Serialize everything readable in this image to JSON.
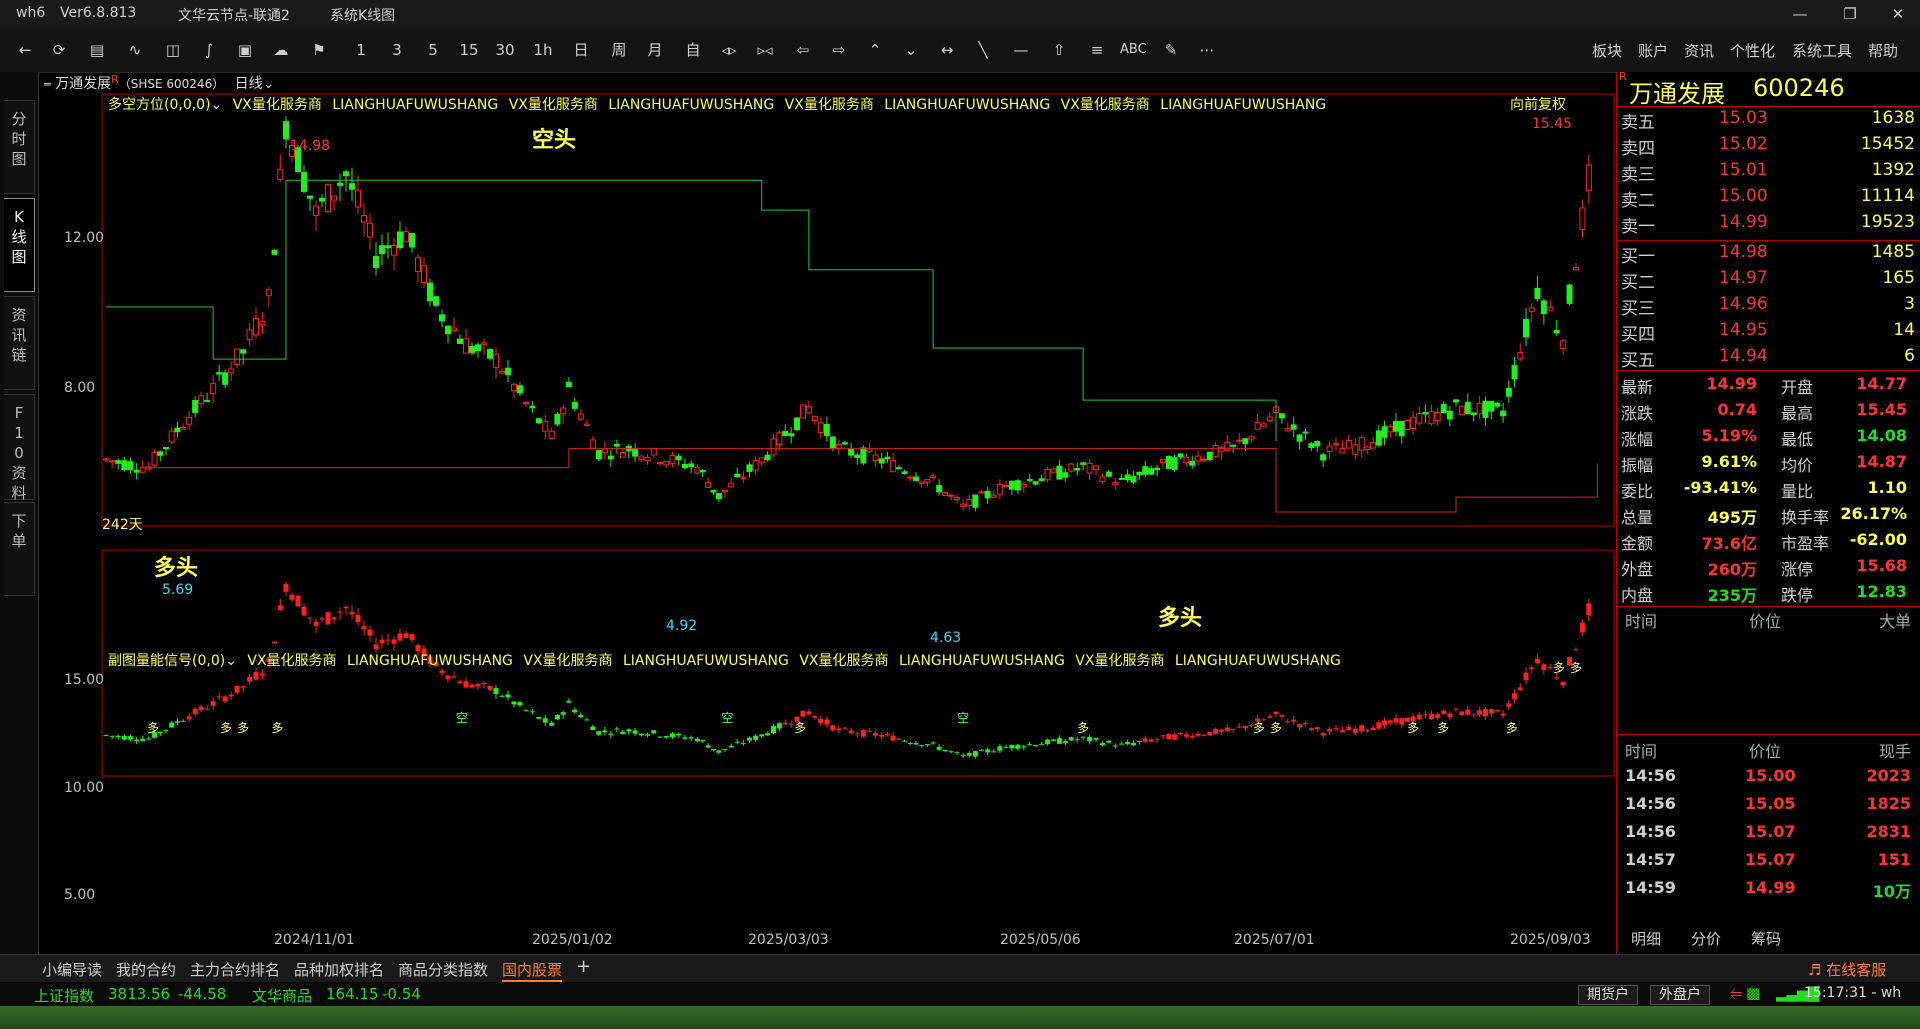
{
  "window": {
    "app": "wh6",
    "version": "Ver6.8.813",
    "node": "文华云节点-联通2",
    "view": "系统K线图"
  },
  "toolbar": {
    "periods": [
      "1",
      "3",
      "5",
      "15",
      "30",
      "1h",
      "日",
      "周",
      "月",
      "自"
    ],
    "text_tools": [
      "ABC"
    ],
    "menus": [
      "板块",
      "账户",
      "资讯",
      "个性化",
      "系统工具",
      "帮助"
    ]
  },
  "left_tabs": [
    "分时图",
    "K线图",
    "资讯链",
    "F10资料",
    "下单"
  ],
  "chart": {
    "symbol_title": "万通发展",
    "symbol_code": "（SHSE 600246）",
    "period": "日线",
    "main_indicator": "多空方位(0,0,0)",
    "watermark_items": [
      "VX量化服务商",
      "LIANGHUAFUWUSHANG",
      "VX量化服务商",
      "LIANGHUAFUWUSHANG",
      "VX量化服务商",
      "LIANGHUAFUWUSHANG",
      "VX量化服务商",
      "LIANGHUAFUWUSHANG"
    ],
    "adjust_label": "向前复权",
    "days_label": "242天",
    "main_y_ticks": [
      "12.00",
      "8.00"
    ],
    "sub_indicator": "副图量能信号(0,0)",
    "sub_watermark_items": [
      "VX量化服务商",
      "LIANGHUAFUWUSHANG",
      "VX量化服务商",
      "LIANGHUAFUWUSHANG",
      "VX量化服务商",
      "LIANGHUAFUWUSHANG",
      "VX量化服务商",
      "LIANGHUAFUWUSHANG"
    ],
    "sub_y_ticks": [
      "15.00",
      "10.00",
      "5.00"
    ],
    "x_ticks": [
      "2024/11/01",
      "2025/01/02",
      "2025/03/03",
      "2025/05/06",
      "2025/07/01",
      "2025/09/03"
    ],
    "annotations": {
      "high": "14.98",
      "low1": "5.69",
      "low2": "4.92",
      "low3": "4.63",
      "last_high": "15.45",
      "bull1": "多头",
      "bear": "空头",
      "bull2": "多头"
    },
    "sub_markers": {
      "bull": "多",
      "bear": "空"
    }
  },
  "chart_data": {
    "type": "candlestick",
    "title": "万通发展（SHSE 600246） 日线",
    "ylim": [
      4.5,
      15.5
    ],
    "x": [
      "2024/11/01",
      "2025/01/02",
      "2025/03/03",
      "2025/05/06",
      "2025/07/01",
      "2025/09/03"
    ],
    "close_path": [
      [
        "2024/09/20",
        5.9
      ],
      [
        "2024/09/30",
        5.69
      ],
      [
        "2024/10/08",
        6.9
      ],
      [
        "2024/10/15",
        7.8
      ],
      [
        "2024/10/22",
        8.8
      ],
      [
        "2024/10/28",
        10.2
      ],
      [
        "2024/11/01",
        14.98
      ],
      [
        "2024/11/08",
        12.5
      ],
      [
        "2024/11/15",
        13.6
      ],
      [
        "2024/11/22",
        11.4
      ],
      [
        "2024/11/29",
        12.0
      ],
      [
        "2024/12/06",
        10.0
      ],
      [
        "2024/12/13",
        9.0
      ],
      [
        "2024/12/20",
        8.6
      ],
      [
        "2024/12/27",
        7.4
      ],
      [
        "2025/01/02",
        6.5
      ],
      [
        "2025/01/06",
        7.8
      ],
      [
        "2025/01/13",
        6.1
      ],
      [
        "2025/01/20",
        6.2
      ],
      [
        "2025/02/05",
        5.7
      ],
      [
        "2025/02/10",
        4.92
      ],
      [
        "2025/02/20",
        5.9
      ],
      [
        "2025/03/03",
        7.3
      ],
      [
        "2025/03/10",
        6.2
      ],
      [
        "2025/03/20",
        5.9
      ],
      [
        "2025/04/01",
        5.3
      ],
      [
        "2025/04/08",
        4.63
      ],
      [
        "2025/04/18",
        5.2
      ],
      [
        "2025/05/06",
        5.7
      ],
      [
        "2025/05/15",
        5.3
      ],
      [
        "2025/05/26",
        5.8
      ],
      [
        "2025/06/10",
        6.2
      ],
      [
        "2025/06/20",
        7.1
      ],
      [
        "2025/07/01",
        6.1
      ],
      [
        "2025/07/10",
        6.3
      ],
      [
        "2025/07/22",
        6.9
      ],
      [
        "2025/08/01",
        7.3
      ],
      [
        "2025/08/12",
        7.2
      ],
      [
        "2025/08/20",
        10.5
      ],
      [
        "2025/08/26",
        9.2
      ],
      [
        "2025/09/01",
        13.4
      ],
      [
        "2025/09/03",
        14.99
      ]
    ],
    "series": [
      {
        "name": "空头",
        "values": [
          [
            "2024/09/20",
            10.0
          ],
          [
            "2024/10/15",
            8.6
          ],
          [
            "2024/11/01",
            13.4
          ],
          [
            "2025/01/02",
            13.4
          ],
          [
            "2025/02/20",
            12.6
          ],
          [
            "2025/03/03",
            11.0
          ],
          [
            "2025/04/01",
            8.9
          ],
          [
            "2025/05/06",
            7.5
          ],
          [
            "2025/06/20",
            6.4
          ]
        ]
      },
      {
        "name": "多头",
        "values": [
          [
            "2024/09/30",
            5.69
          ],
          [
            "2025/01/02",
            5.69
          ],
          [
            "2025/01/06",
            6.2
          ],
          [
            "2025/06/20",
            4.5
          ],
          [
            "2025/08/01",
            4.9
          ],
          [
            "2025/09/03",
            5.8
          ]
        ]
      }
    ]
  },
  "orderbook": {
    "title": "万通发展",
    "code": "600246",
    "asks": [
      {
        "label": "卖五",
        "price": "15.03",
        "vol": "1638"
      },
      {
        "label": "卖四",
        "price": "15.02",
        "vol": "15452"
      },
      {
        "label": "卖三",
        "price": "15.01",
        "vol": "1392"
      },
      {
        "label": "卖二",
        "price": "15.00",
        "vol": "11114"
      },
      {
        "label": "卖一",
        "price": "14.99",
        "vol": "19523"
      }
    ],
    "bids": [
      {
        "label": "买一",
        "price": "14.98",
        "vol": "1485"
      },
      {
        "label": "买二",
        "price": "14.97",
        "vol": "165"
      },
      {
        "label": "买三",
        "price": "14.96",
        "vol": "3"
      },
      {
        "label": "买四",
        "price": "14.95",
        "vol": "14"
      },
      {
        "label": "买五",
        "price": "14.94",
        "vol": "6"
      }
    ]
  },
  "quote": [
    {
      "l1": "最新",
      "v1": "14.99",
      "c1": "#ff3333",
      "l2": "开盘",
      "v2": "14.77",
      "c2": "#ff3333"
    },
    {
      "l1": "涨跌",
      "v1": "0.74",
      "c1": "#ff3333",
      "l2": "最高",
      "v2": "15.45",
      "c2": "#ff3333"
    },
    {
      "l1": "涨幅",
      "v1": "5.19%",
      "c1": "#ff3333",
      "l2": "最低",
      "v2": "14.08",
      "c2": "#22dd22"
    },
    {
      "l1": "振幅",
      "v1": "9.61%",
      "c1": "#ffff55",
      "l2": "均价",
      "v2": "14.87",
      "c2": "#ff3333"
    },
    {
      "l1": "委比",
      "v1": "-93.41%",
      "c1": "#ffff55",
      "l2": "量比",
      "v2": "1.10",
      "c2": "#ffff55"
    },
    {
      "l1": "总量",
      "v1": "495万",
      "c1": "#ffff55",
      "l2": "换手率",
      "v2": "26.17%",
      "c2": "#ffff55"
    },
    {
      "l1": "金额",
      "v1": "73.6亿",
      "c1": "#ff3333",
      "l2": "市盈率",
      "v2": "-62.00",
      "c2": "#ffff55"
    },
    {
      "l1": "外盘",
      "v1": "260万",
      "c1": "#ff3333",
      "l2": "涨停",
      "v2": "15.68",
      "c2": "#ff3333"
    },
    {
      "l1": "内盘",
      "v1": "235万",
      "c1": "#22dd22",
      "l2": "跌停",
      "v2": "12.83",
      "c2": "#22dd22"
    }
  ],
  "bigorders": {
    "h_time": "时间",
    "h_price": "价位",
    "h_vol": "大单"
  },
  "ticks": {
    "h_time": "时间",
    "h_price": "价位",
    "h_vol": "现手",
    "rows": [
      {
        "time": "14:56",
        "price": "15.00",
        "vol": "2023",
        "vcolor": "#ff3333"
      },
      {
        "time": "14:56",
        "price": "15.05",
        "vol": "1825",
        "vcolor": "#ff3333"
      },
      {
        "time": "14:56",
        "price": "15.07",
        "vol": "2831",
        "vcolor": "#ff3333"
      },
      {
        "time": "14:57",
        "price": "15.07",
        "vol": "151",
        "vcolor": "#ff3333"
      },
      {
        "time": "14:59",
        "price": "14.99",
        "vol": "10万",
        "vcolor": "#22dd22"
      }
    ],
    "tabs": [
      "明细",
      "分价",
      "筹码"
    ]
  },
  "bottom_tabs": [
    "小编导读",
    "我的合约",
    "主力合约排名",
    "品种加权排名",
    "商品分类指数",
    "国内股票"
  ],
  "service": "在线客服",
  "status": {
    "idx1_name": "上证指数",
    "idx1_val": "3813.56",
    "idx1_chg": "-44.58",
    "idx2_name": "文华商品",
    "idx2_val": "164.15",
    "idx2_chg": "-0.54",
    "btn1": "期货户",
    "btn2": "外盘户",
    "clock": "15:17:31 - wh"
  },
  "colors": {
    "up": "#ff2020",
    "down": "#22ee22",
    "bear_line": "#22cc22",
    "bull_line": "#dd2222",
    "label_yellow": "#ffff55",
    "border": "#c00000"
  }
}
